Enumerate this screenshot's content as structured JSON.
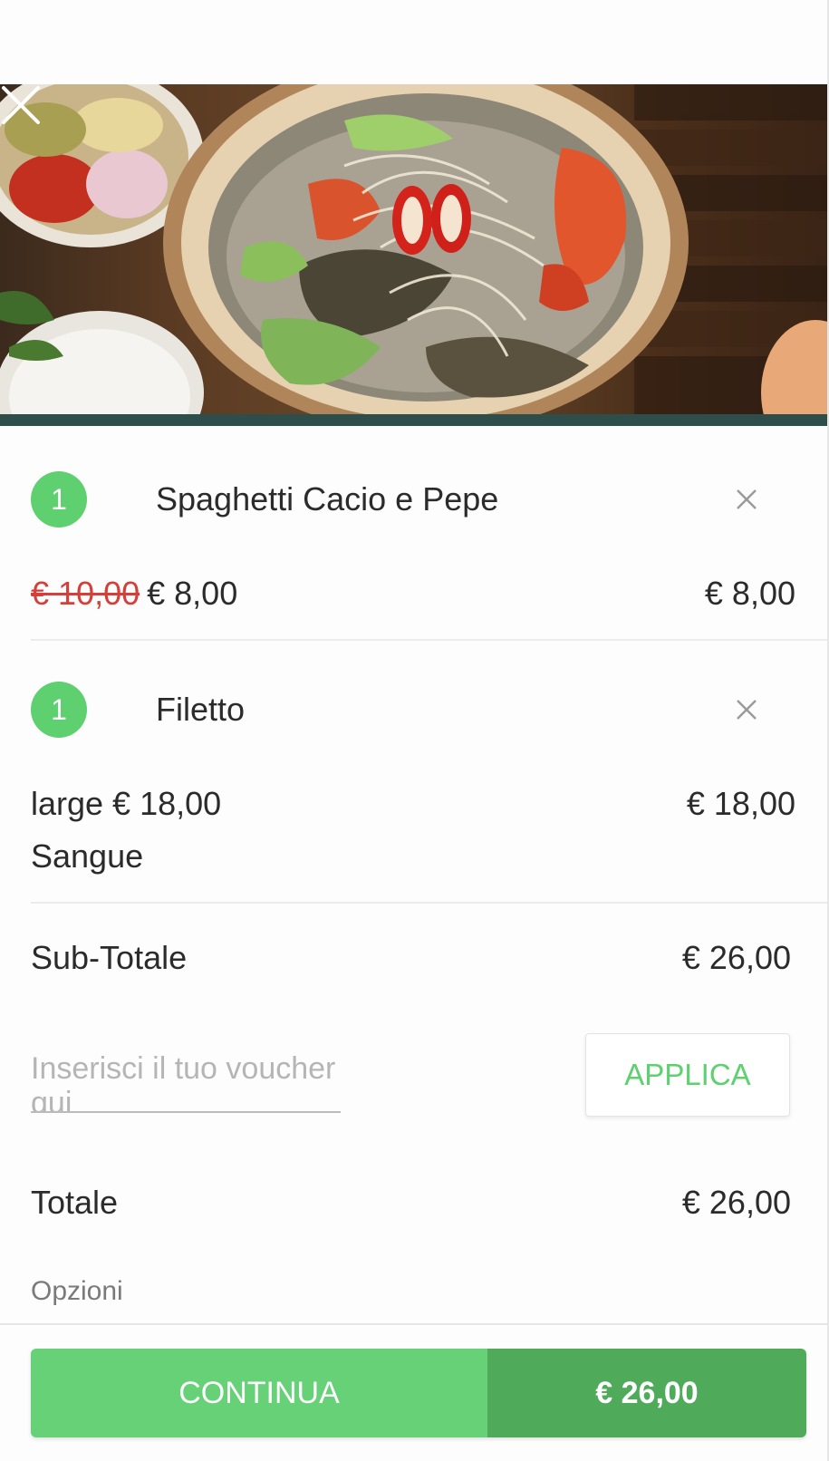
{
  "cart": {
    "items": [
      {
        "quantity": "1",
        "name": "Spaghetti Cacio e Pepe",
        "old_price": "€ 10,00",
        "price": "€ 8,00",
        "line_total": "€ 8,00"
      },
      {
        "quantity": "1",
        "name": "Filetto",
        "variant_price": "large € 18,00",
        "option": "Sangue",
        "line_total": "€ 18,00"
      }
    ],
    "subtotal_label": "Sub-Totale",
    "subtotal_value": "€ 26,00",
    "voucher": {
      "placeholder": "Inserisci il tuo voucher qui",
      "value": "",
      "apply_label": "APPLICA"
    },
    "total_label": "Totale",
    "total_value": "€ 26,00",
    "options_label": "Opzioni"
  },
  "footer": {
    "continue_label": "CONTINUA",
    "total_label": "€ 26,00"
  },
  "colors": {
    "accent_green": "#5fd06f",
    "continue_green": "#66d177",
    "dark_green": "#4faa5a",
    "strike_red": "#d43f3a"
  }
}
